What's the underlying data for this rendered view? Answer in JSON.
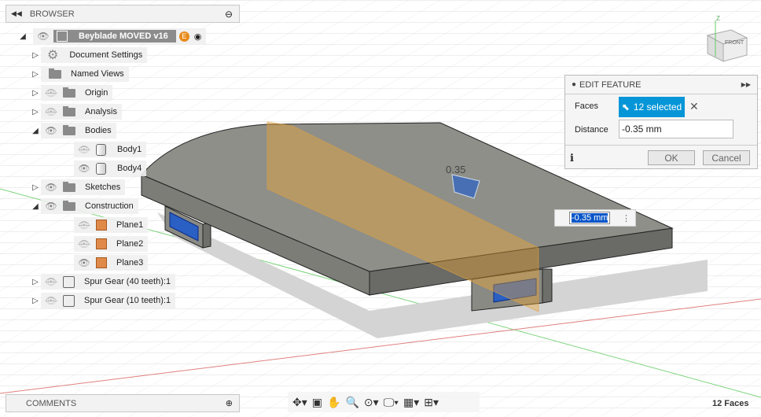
{
  "browser": {
    "title": "BROWSER",
    "root": {
      "label": "Beyblade MOVED v16",
      "badge": "E"
    },
    "items": [
      {
        "label": "Document Settings"
      },
      {
        "label": "Named Views"
      },
      {
        "label": "Origin"
      },
      {
        "label": "Analysis"
      },
      {
        "label": "Bodies"
      },
      {
        "label": "Body1"
      },
      {
        "label": "Body4"
      },
      {
        "label": "Sketches"
      },
      {
        "label": "Construction"
      },
      {
        "label": "Plane1"
      },
      {
        "label": "Plane2"
      },
      {
        "label": "Plane3"
      },
      {
        "label": "Spur Gear (40 teeth):1"
      },
      {
        "label": "Spur Gear (10 teeth):1"
      }
    ]
  },
  "edit_feature": {
    "title": "EDIT FEATURE",
    "faces_label": "Faces",
    "faces_value": "12 selected",
    "distance_label": "Distance",
    "distance_value": "-0.35 mm",
    "ok": "OK",
    "cancel": "Cancel"
  },
  "viewport": {
    "dimension_label": "0.35",
    "inline_input": "-0.35 mm",
    "viewcube_face": "FRONT",
    "viewcube_axis": "Z"
  },
  "comments": {
    "title": "COMMENTS"
  },
  "status": {
    "selection": "12 Faces"
  },
  "colors": {
    "accent": "#0696d7",
    "plane": "#f0a830",
    "body": "#8c8c86"
  }
}
